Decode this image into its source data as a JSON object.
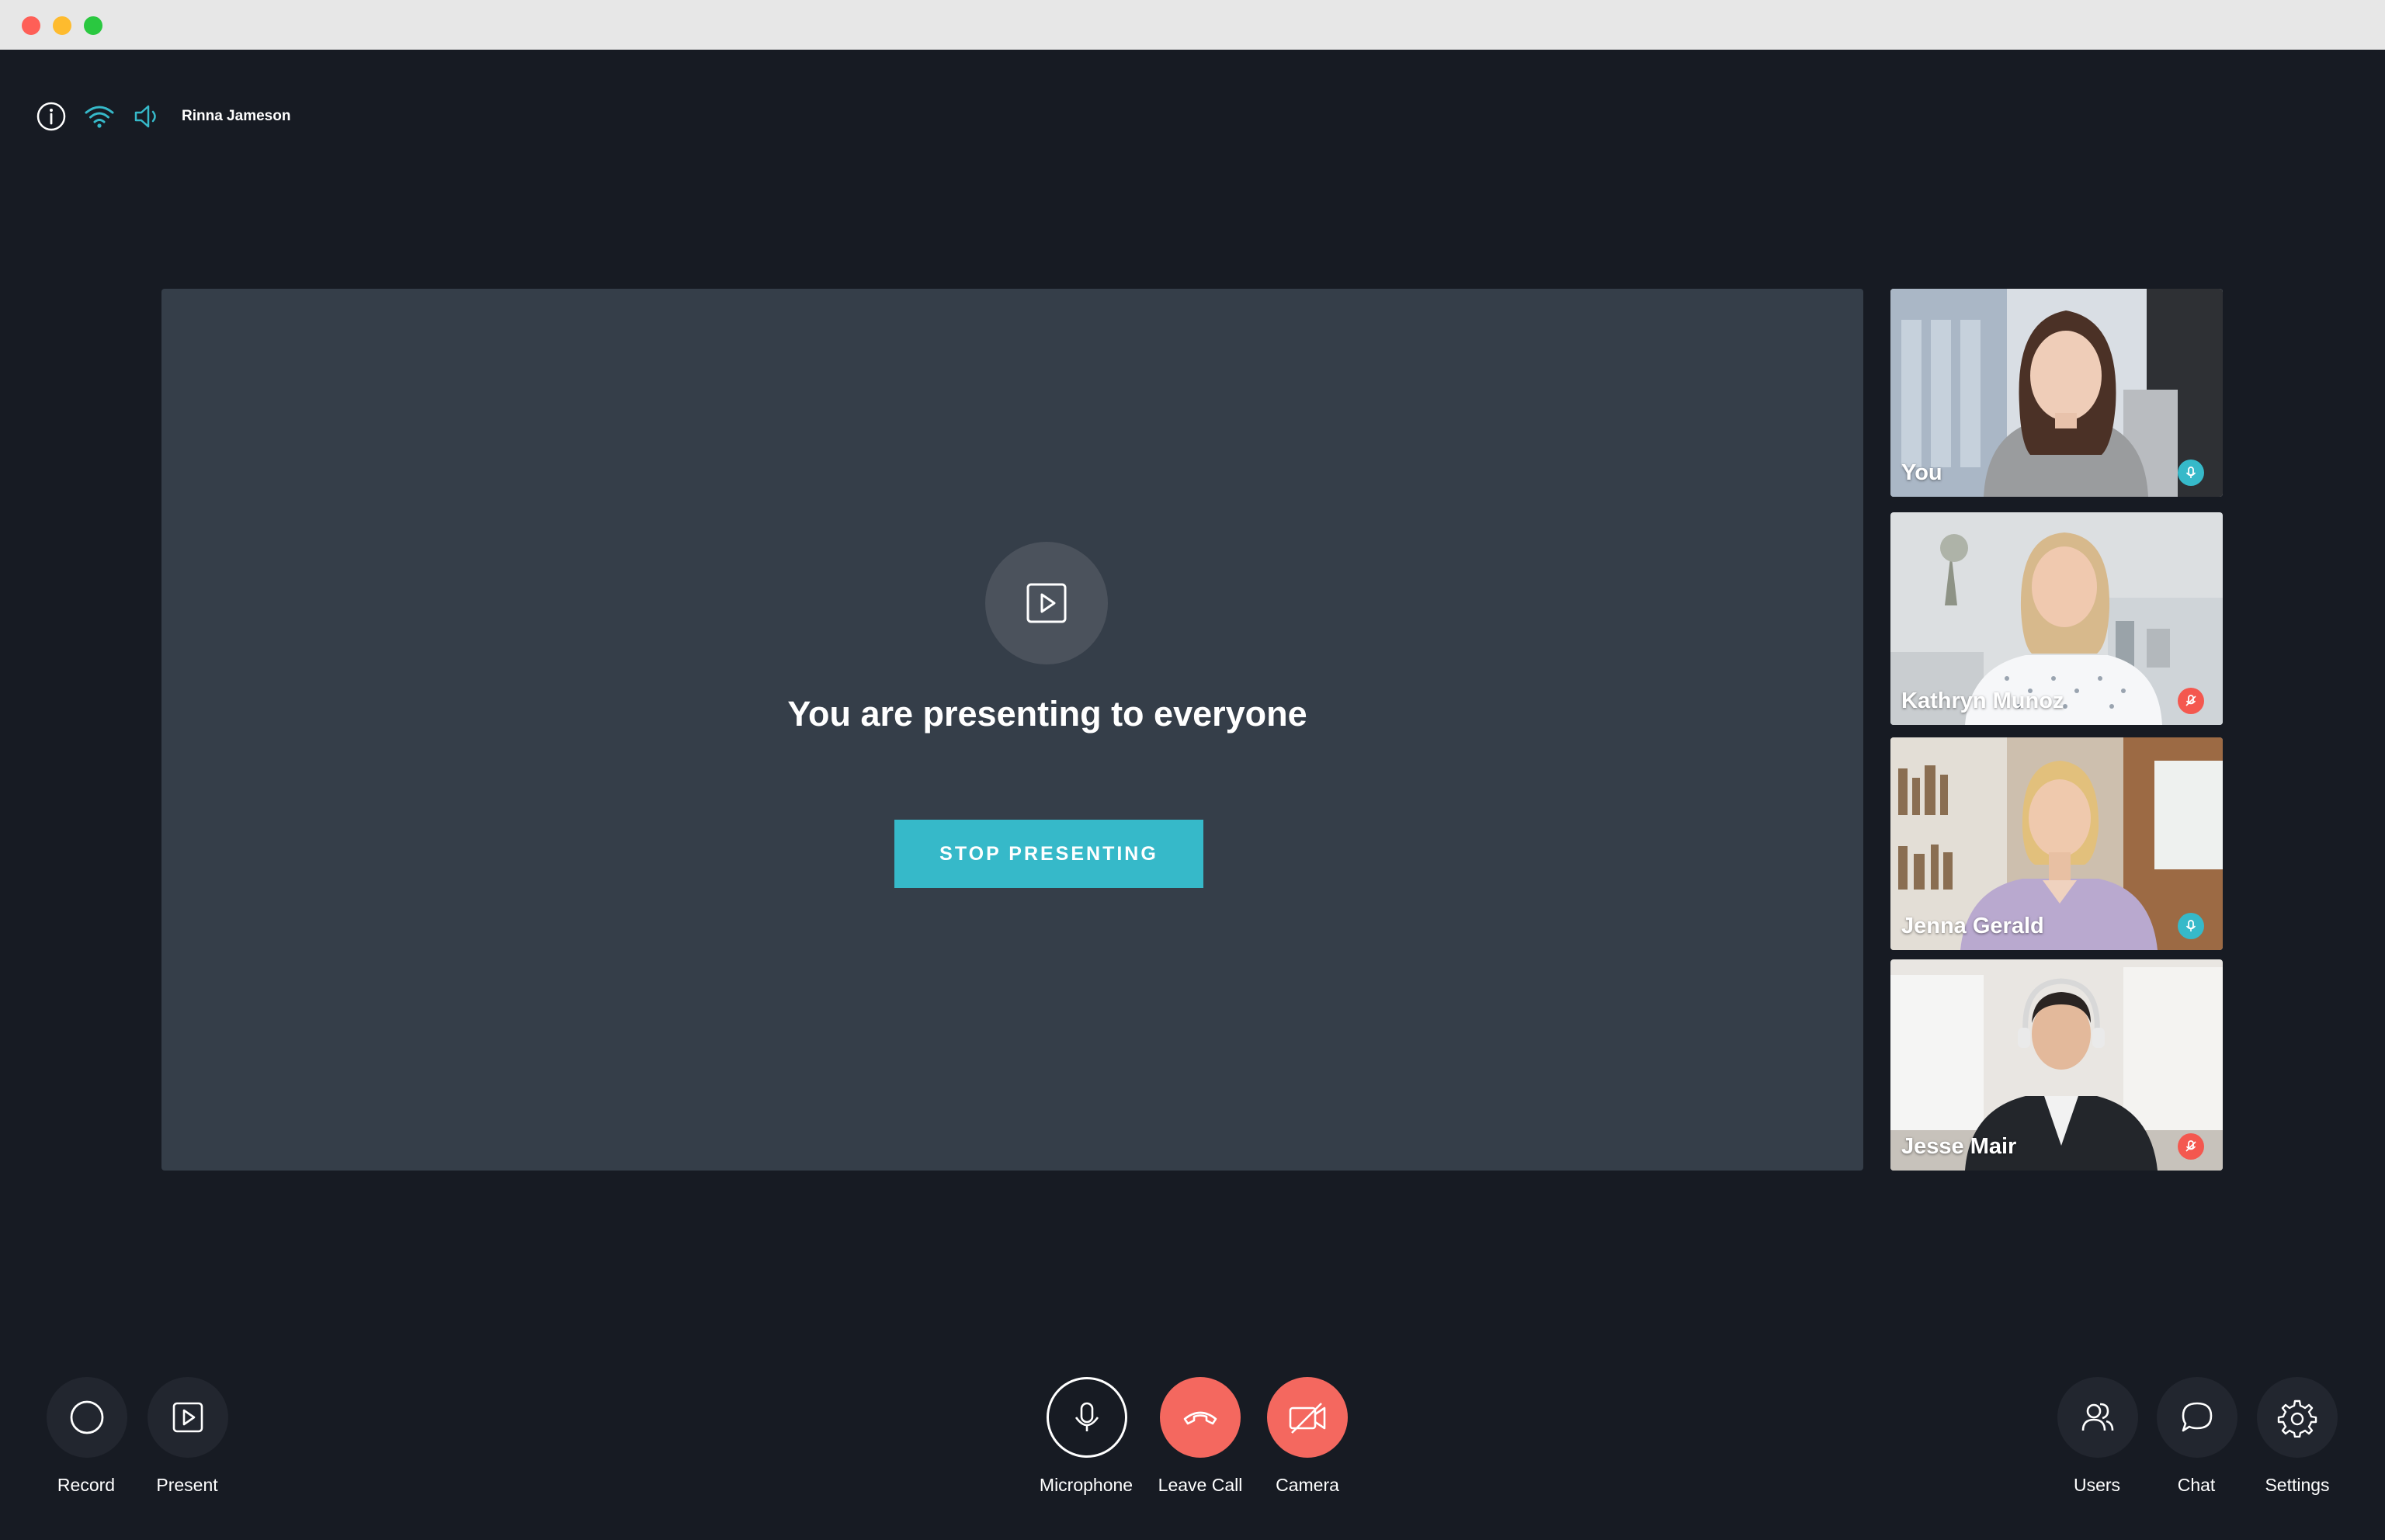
{
  "window": {
    "traffic_lights": [
      "close",
      "minimize",
      "maximize"
    ]
  },
  "status_bar": {
    "icons": [
      "info-icon",
      "wifi-icon",
      "speaker-icon"
    ],
    "user_name": "Rinna Jameson"
  },
  "stage": {
    "title": "You are presenting to everyone",
    "stop_label": "STOP PRESENTING"
  },
  "participants": [
    {
      "name": "You",
      "mic": "on"
    },
    {
      "name": "Kathryn Munoz",
      "mic": "muted"
    },
    {
      "name": "Jenna Gerald",
      "mic": "on"
    },
    {
      "name": "Jesse Mair",
      "mic": "muted"
    }
  ],
  "controls": {
    "record": "Record",
    "present": "Present",
    "microphone": "Microphone",
    "leave_call": "Leave Call",
    "camera": "Camera",
    "users": "Users",
    "chat": "Chat",
    "settings": "Settings"
  },
  "colors": {
    "background": "#171b23",
    "stage": "#353e49",
    "accent": "#36b9c9",
    "danger": "#f4685f"
  }
}
